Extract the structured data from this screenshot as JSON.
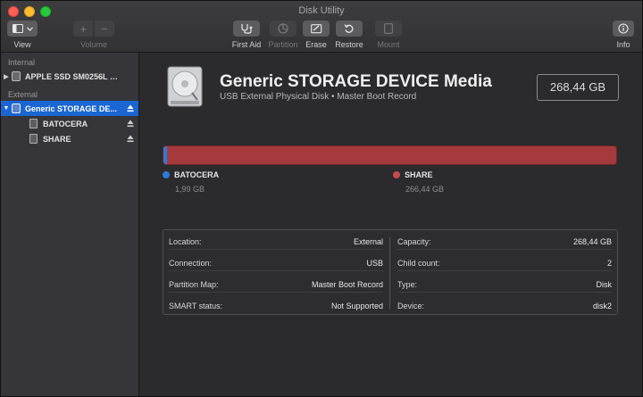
{
  "window": {
    "title": "Disk Utility"
  },
  "toolbar": {
    "view_label": "View",
    "volume_label": "Volume",
    "volume_add": "+",
    "volume_remove": "−",
    "first_aid_label": "First Aid",
    "partition_label": "Partition",
    "erase_label": "Erase",
    "restore_label": "Restore",
    "mount_label": "Mount",
    "info_label": "Info"
  },
  "sidebar": {
    "internal_header": "Internal",
    "external_header": "External",
    "internal_items": [
      {
        "label": "APPLE SSD SM0256L Me..."
      }
    ],
    "external_items": [
      {
        "label": "Generic STORAGE DE...",
        "selected": true
      }
    ],
    "volumes": [
      {
        "label": "BATOCERA"
      },
      {
        "label": "SHARE"
      }
    ]
  },
  "disk": {
    "name": "Generic STORAGE DEVICE Media",
    "subtitle": "USB External Physical Disk • Master Boot Record",
    "capacity": "268,44 GB"
  },
  "partitions": [
    {
      "name": "BATOCERA",
      "size": "1,99 GB",
      "color": "#2f7ad6",
      "fraction": 0.0074
    },
    {
      "name": "SHARE",
      "size": "266,44 GB",
      "color": "#c84a4c",
      "fraction": 0.9926
    }
  ],
  "info": {
    "left": [
      {
        "key": "Location:",
        "value": "External"
      },
      {
        "key": "Connection:",
        "value": "USB"
      },
      {
        "key": "Partition Map:",
        "value": "Master Boot Record"
      },
      {
        "key": "SMART status:",
        "value": "Not Supported"
      }
    ],
    "right": [
      {
        "key": "Capacity:",
        "value": "268,44 GB"
      },
      {
        "key": "Child count:",
        "value": "2"
      },
      {
        "key": "Type:",
        "value": "Disk"
      },
      {
        "key": "Device:",
        "value": "disk2"
      }
    ]
  }
}
